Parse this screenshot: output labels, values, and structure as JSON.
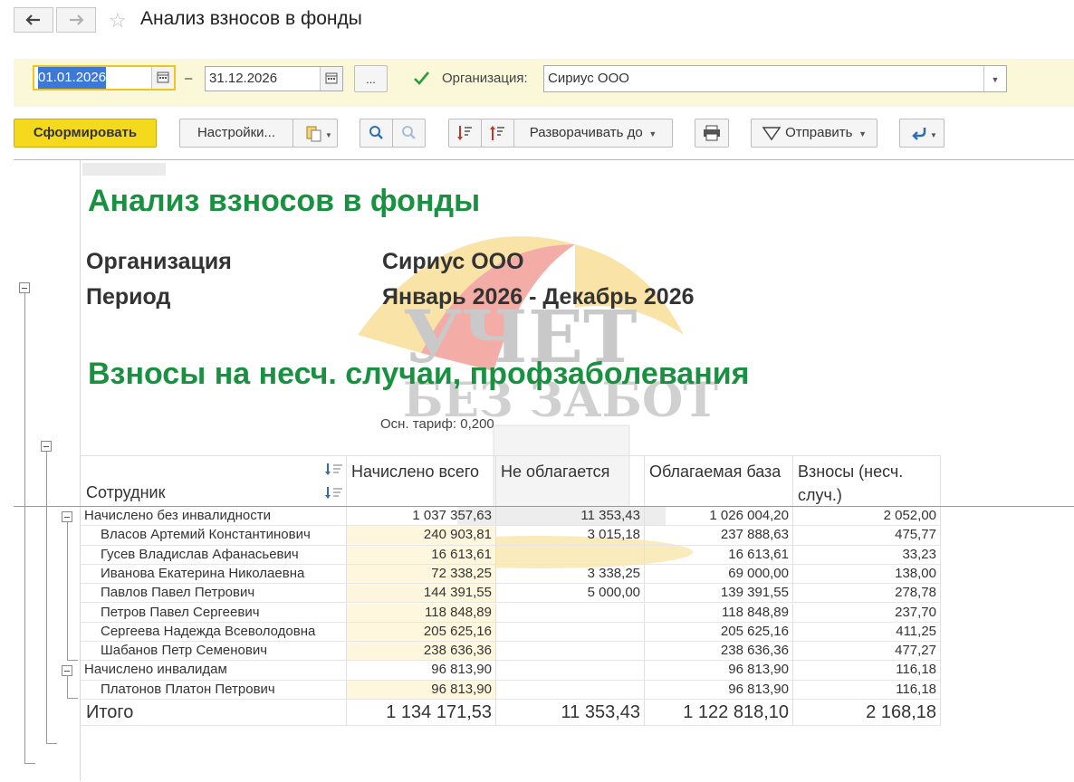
{
  "window": {
    "title": "Анализ взносов в фонды"
  },
  "params": {
    "date_from": "01.01.2026",
    "date_sep": "–",
    "date_to": "31.12.2026",
    "more_label": "...",
    "org_checked": true,
    "org_label": "Организация:",
    "org_value": "Сириус ООО"
  },
  "toolbar": {
    "generate": "Сформировать",
    "settings": "Настройки...",
    "expand": "Разворачивать до",
    "send": "Отправить"
  },
  "report": {
    "title": "Анализ взносов в фонды",
    "org_label": "Организация",
    "org_value": "Сириус ООО",
    "period_label": "Период",
    "period_value": "Январь 2026 - Декабрь 2026",
    "section_title": "Взносы на несч. случаи, профзаболевания",
    "rate_note": "Осн. тариф: 0,200",
    "watermark_line1": "УЧЕТ",
    "watermark_line2": "БЕЗ ЗАБОТ",
    "columns": {
      "employee": "Сотрудник",
      "accrued": "Начислено всего",
      "exempt": "Не облагается",
      "base": "Облагаемая база",
      "contrib": "Взносы (несч. случ.)"
    },
    "rows": [
      {
        "name": "Начислено без инвалидности",
        "accrued": "1 037 357,63",
        "exempt": "11 353,43",
        "base": "1 026 004,20",
        "contrib": "2 052,00",
        "group": true
      },
      {
        "name": "Власов Артемий Константинович",
        "accrued": "240 903,81",
        "exempt": "3 015,18",
        "base": "237 888,63",
        "contrib": "475,77",
        "group": false
      },
      {
        "name": "Гусев Владислав Афанасьевич",
        "accrued": "16 613,61",
        "exempt": "",
        "base": "16 613,61",
        "contrib": "33,23",
        "group": false
      },
      {
        "name": "Иванова Екатерина Николаевна",
        "accrued": "72 338,25",
        "exempt": "3 338,25",
        "base": "69 000,00",
        "contrib": "138,00",
        "group": false
      },
      {
        "name": "Павлов Павел Петрович",
        "accrued": "144 391,55",
        "exempt": "5 000,00",
        "base": "139 391,55",
        "contrib": "278,78",
        "group": false
      },
      {
        "name": "Петров Павел Сергеевич",
        "accrued": "118 848,89",
        "exempt": "",
        "base": "118 848,89",
        "contrib": "237,70",
        "group": false
      },
      {
        "name": "Сергеева Надежда Всеволодовна",
        "accrued": "205 625,16",
        "exempt": "",
        "base": "205 625,16",
        "contrib": "411,25",
        "group": false
      },
      {
        "name": "Шабанов Петр Семенович",
        "accrued": "238 636,36",
        "exempt": "",
        "base": "238 636,36",
        "contrib": "477,27",
        "group": false
      },
      {
        "name": "Начислено инвалидам",
        "accrued": "96 813,90",
        "exempt": "",
        "base": "96 813,90",
        "contrib": "116,18",
        "group": true
      },
      {
        "name": "Платонов Платон Петрович",
        "accrued": "96 813,90",
        "exempt": "",
        "base": "96 813,90",
        "contrib": "116,18",
        "group": false
      }
    ],
    "total": {
      "name": "Итого",
      "accrued": "1 134 171,53",
      "exempt": "11 353,43",
      "base": "1 122 818,10",
      "contrib": "2 168,18"
    }
  },
  "colors": {
    "accent_yellow": "#f5d91c",
    "title_green": "#1a9140",
    "param_band": "#fbf7d9",
    "date_selection": "#3b78d8"
  }
}
